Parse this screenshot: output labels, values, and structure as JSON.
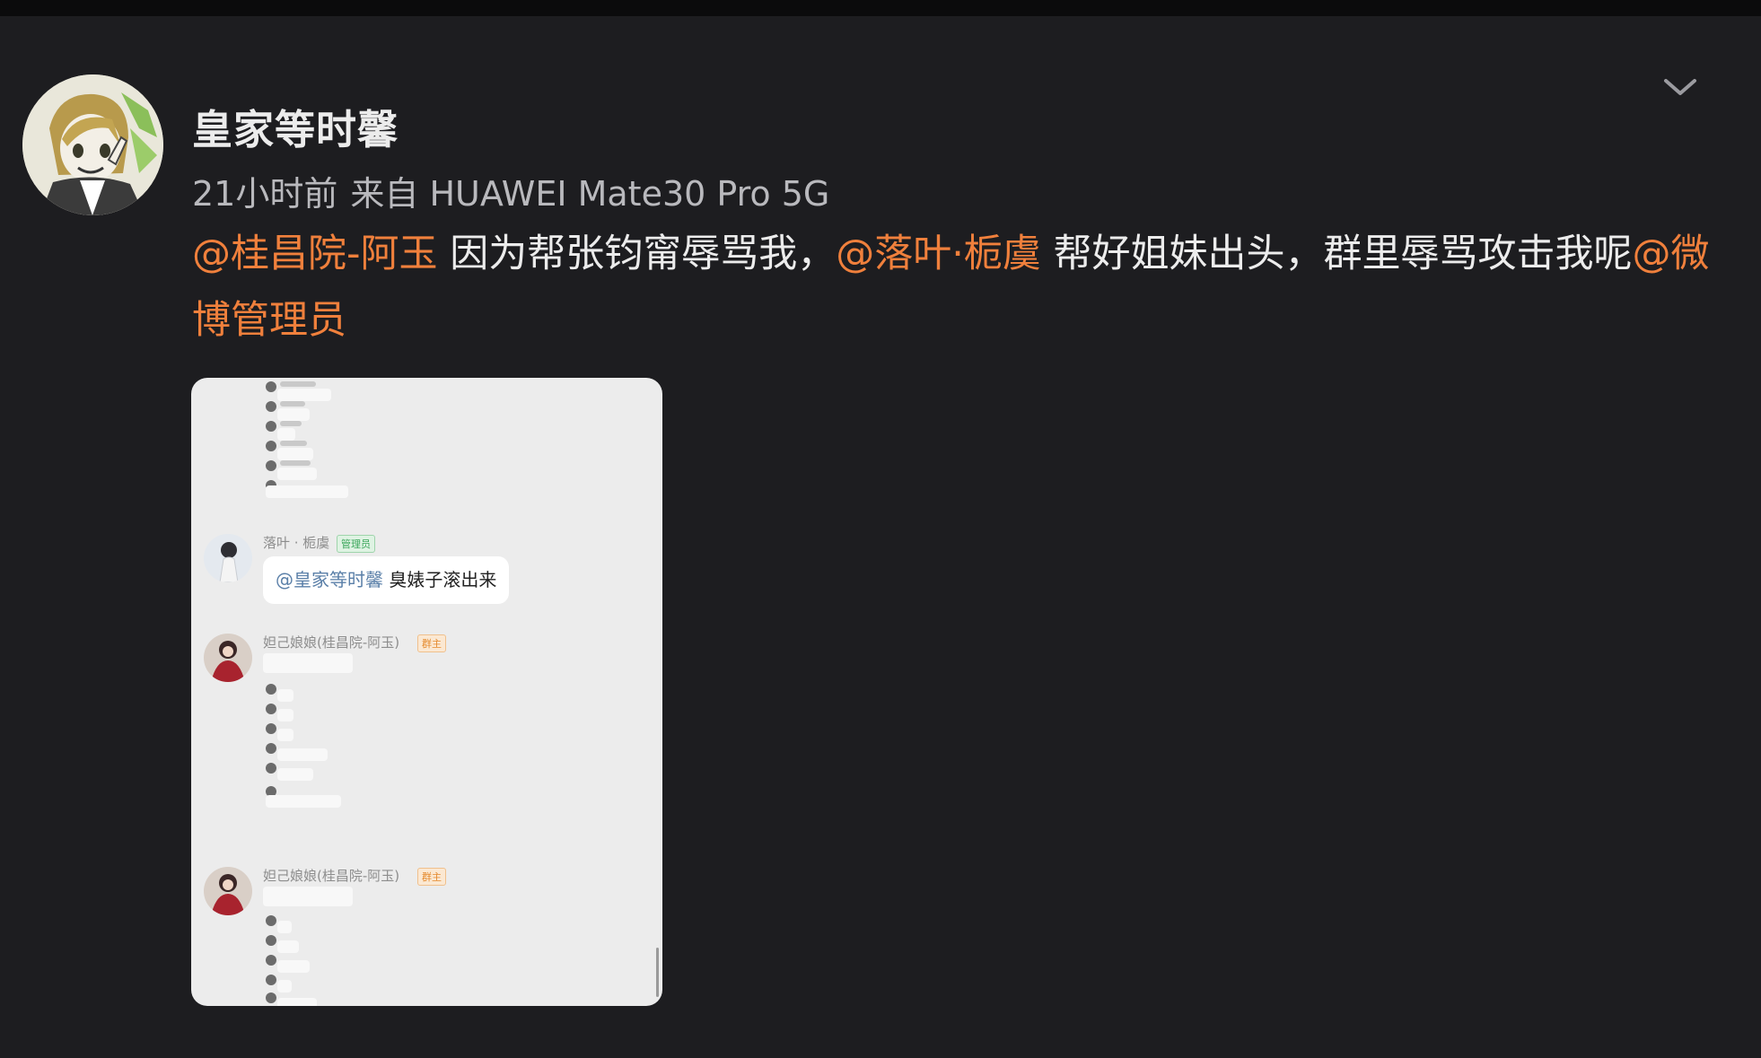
{
  "post": {
    "username": "皇家等时馨",
    "time": "21小时前",
    "source": "来自 HUAWEI Mate30 Pro 5G",
    "text": {
      "mention1": "@桂昌院-阿玉",
      "part1": " 因为帮张钧甯辱骂我，",
      "mention2": "@落叶·栀虞",
      "part2": " 帮好姐妹出头，群里辱骂攻击我呢",
      "mention3": "@微博管理员"
    }
  },
  "screenshot": {
    "msg1": {
      "sender": "落叶 · 栀虞",
      "tag": "管理员",
      "at": "@皇家等时馨",
      "text": " 臭婊子滚出来"
    },
    "msg2": {
      "sender": "妲己娘娘(桂昌院-阿玉)",
      "tag": "群主"
    },
    "msg3": {
      "sender": "妲己娘娘(桂昌院-阿玉)",
      "tag": "群主"
    }
  },
  "colors": {
    "background": "#1d1d20",
    "mention": "#f0803c",
    "text": "#ececec",
    "meta": "#b9b9bd"
  },
  "icons": {
    "expand": "chevron-down-icon"
  }
}
